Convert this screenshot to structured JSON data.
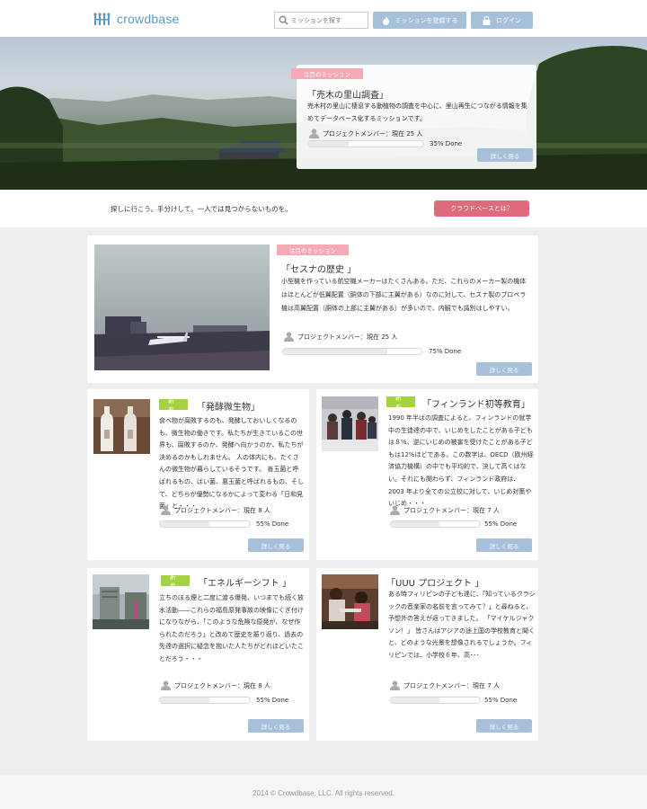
{
  "header": {
    "logo_text": "crowdbase",
    "search_placeholder": "ミッションを探す",
    "register_label": "ミッションを登録する",
    "login_label": "ログイン"
  },
  "hero": {
    "tag": "注目のミッション",
    "title": "「売木の里山調査」",
    "description": "売木村の里山に棲息する動植物の調査を中心に、里山再生につながる情報を集めてデータベース化するミッションです。",
    "members": "プロジェクトメンバー：現在 25 人",
    "progress": 0.35,
    "progress_label": "35% Done",
    "more_label": "詳しく見る"
  },
  "band": {
    "tagline": "探しに行こう。手分けして。一人では見つからないものを。",
    "about_label": "クラウドベースとは？"
  },
  "featured": {
    "tag": "注目のミッション",
    "title": "「セスナの歴史 」",
    "description": "小型機を作っている航空機メーカーはたくさんある。ただ、これらのメーカー製の機体はほとんどが低翼配置（胴体の下部に主翼がある）なのに対して、セスナ製のプロペラ機は高翼配置（胴体の上部に主翼がある）が多いので、内観でも識別はしやすい。",
    "members": "プロジェクトメンバー：現在 25 人",
    "progress": 0.75,
    "progress_label": "75% Done",
    "more_label": "詳しく見る"
  },
  "missions": [
    {
      "tag": "新着",
      "title": "「発酵微生物」",
      "description": "食べ物が腐敗するのも、発酵しておいしくなるのも、微生物の働きです。私たちが生きているこの世界も、腐敗するのか、発酵へ向かうのか、私たちが決めるのかもしれません。 人の体内にも、たくさんの微生物が暮らしているそうです。 善玉菌と呼ばれるもの、ばい菌、悪玉菌と呼ばれるもの、そして、どちらが優勢になるかによって変わる「日和見菌」と・・・",
      "members": "プロジェクトメンバー：現在 8 人",
      "progress": 0.55,
      "progress_label": "55% Done",
      "more_label": "詳しく見る"
    },
    {
      "tag": "新着",
      "title": "「フィンランド初等教育」",
      "description": "1990 年半ばの調査によると、フィンランドの就学中の生徒達の中で、いじめをしたことがある子どもは８%、逆にいじめの被害を受けたことがある子どもは12%ほどである。この数字は、OECD（欧州経済協力機構）の中でも平均的で、決して高くはない。それにも関わらず、フィンランド政府は、2003 年より全ての公立校に対して、いじめ対策やいじめ・・・",
      "members": "プロジェクトメンバー：現在 7 人",
      "progress": 0.55,
      "progress_label": "55% Done",
      "more_label": "詳しく見る"
    },
    {
      "tag": "新着",
      "title": "「エネルギーシフト 」",
      "description": "立ちのぼる煙と二度に渡る爆発、いつまでも続く放水活動――これらの福島原発事故の映像にくぎ付けになりながら、「このような危険な原発が、なぜ作られたのだろう」と改めて歴史を振り返り、過去の先達の選択に疑念を抱いた人たちがどれほどいたことだろう・・・",
      "members": "プロジェクトメンバー：現在 8 人",
      "progress": 0.55,
      "progress_label": "55% Done",
      "more_label": "詳しく見る"
    },
    {
      "tag": "",
      "title": "「UUU プロジェクト 」",
      "description": "ある時フィリピンの子ども達に、「知っているクラシックの音楽家の名前を言ってみて？」と尋ねると、予想外の答えが返ってきました。 「マイケルジャクソン！」 皆さんはアジアの途上国の学校教育と聞くと、どのような光景を想像されるでしょうか。フィリピンでは、小学校６年、高･･･",
      "members": "プロジェクトメンバー：現在 7 人",
      "progress": 0.55,
      "progress_label": "55% Done",
      "more_label": "詳しく見る"
    }
  ],
  "footer": {
    "copyright": "2014 © Crowdbase, LLC. All rights reserved."
  },
  "colors": {
    "accent_blue": "#a5c0d8",
    "tag_pink": "#f4a9b4",
    "tag_green": "#a5d243",
    "about_button": "#de6a7c",
    "logo": "#5a9ac2"
  }
}
